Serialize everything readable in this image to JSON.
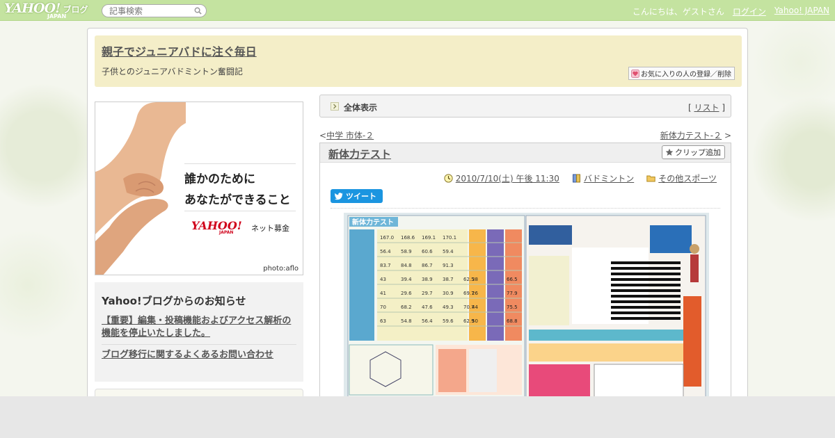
{
  "topbar": {
    "logo_main": "YAHOO!",
    "logo_sub": "JAPAN",
    "logo_service": "ブログ",
    "search_placeholder": "記事検索",
    "greeting": "こんにちは、ゲストさん",
    "login_label": "ログイン",
    "yahoo_link": "Yahoo! JAPAN"
  },
  "header": {
    "title": "親子でジュニアバドに注ぐ毎日",
    "subtitle": "子供とのジュニアバドミントン奮闘記",
    "fav_button": "お気に入りの人の登録／削除"
  },
  "ad": {
    "line1": "誰かのために",
    "line2": "あなたができること",
    "logo_main": "YAHOO!",
    "logo_sub": "JAPAN",
    "logo_suffix": "ネット募金",
    "credit": "photo:aflo"
  },
  "notice": {
    "title": "Yahoo!ブログからのお知らせ",
    "links": [
      "【重要】編集・投稿機能およびアクセス解析の機能を停止いたしました。",
      "ブログ移行に関するよくあるお問い合わせ"
    ]
  },
  "view_bar": {
    "label": "全体表示",
    "list_open": "[ ",
    "list_link": "リスト",
    "list_close": " ]"
  },
  "pager": {
    "prev_arrow": "<",
    "prev_label": "中学 市体-２",
    "next_label": "新体力テスト-２",
    "next_arrow": " >"
  },
  "article": {
    "title": "新体力テスト",
    "clip_label": "クリップ追加",
    "date": "2010/7/10(土) 午後 11:30",
    "category": "バドミントン",
    "folder": "その他スポーツ",
    "tweet_label": "ツイート"
  },
  "photo": {
    "sheet_title": "新体力テスト",
    "rows": [
      [
        "167.0",
        "168.6",
        "169.1",
        "170.1"
      ],
      [
        "56.4",
        "58.9",
        "60.6",
        "59.4"
      ],
      [
        "83.7",
        "84.8",
        "86.7",
        "91.3"
      ],
      [
        "43",
        "39.4",
        "38.9",
        "38.7",
        "62.5"
      ],
      [
        "41",
        "29.6",
        "29.7",
        "30.9",
        "69.7"
      ],
      [
        "70",
        "68.2",
        "47.6",
        "49.3",
        "70.7"
      ],
      [
        "63",
        "54.8",
        "56.4",
        "59.6",
        "62.9"
      ]
    ],
    "scores": [
      "38",
      "26",
      "44",
      "50",
      "66.5",
      "77.9",
      "75.5",
      "68.8"
    ]
  }
}
